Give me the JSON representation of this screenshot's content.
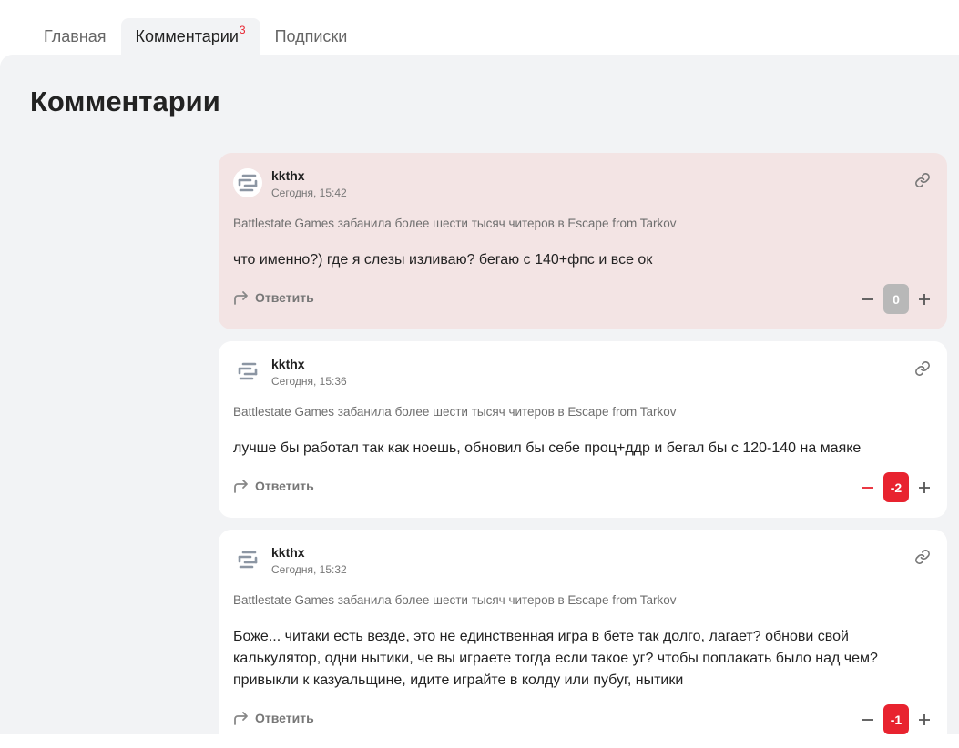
{
  "tabs": [
    {
      "label": "Главная"
    },
    {
      "label": "Комментарии",
      "badge": "3"
    },
    {
      "label": "Подписки"
    }
  ],
  "page_title": "Комментарии",
  "comments": [
    {
      "author": "kkthx",
      "date": "Сегодня, 15:42",
      "article": "Battlestate Games забанила более шести тысяч читеров в Escape from Tarkov",
      "text": "что именно?) где я слезы изливаю? бегаю с 140+фпс и все ок",
      "reply_label": "Ответить",
      "score": "0"
    },
    {
      "author": "kkthx",
      "date": "Сегодня, 15:36",
      "article": "Battlestate Games забанила более шести тысяч читеров в Escape from Tarkov",
      "text": "лучше бы работал так как ноешь, обновил бы себе проц+ддр и бегал бы с 120-140 на маяке",
      "reply_label": "Ответить",
      "score": "-2"
    },
    {
      "author": "kkthx",
      "date": "Сегодня, 15:32",
      "article": "Battlestate Games забанила более шести тысяч читеров в Escape from Tarkov",
      "text": "Боже... читаки есть везде, это не единственная игра в бете так долго, лагает? обнови свой калькулятор, одни нытики, че вы играете тогда если такое уг? чтобы поплакать было над чем? привыкли к казуальщине, идите играйте в колду или пубуг, нытики",
      "reply_label": "Ответить",
      "score": "-1"
    }
  ],
  "colors": {
    "accent_red": "#e8232f",
    "neutral_score": "#b8b8b8",
    "highlight_bg": "#f3e4e4",
    "panel_bg": "#f2f3f5"
  },
  "icons": {
    "avatar": "site-logo-icon",
    "link": "link-icon",
    "reply": "reply-arrow-icon",
    "downvote": "minus-icon",
    "upvote": "plus-icon"
  }
}
